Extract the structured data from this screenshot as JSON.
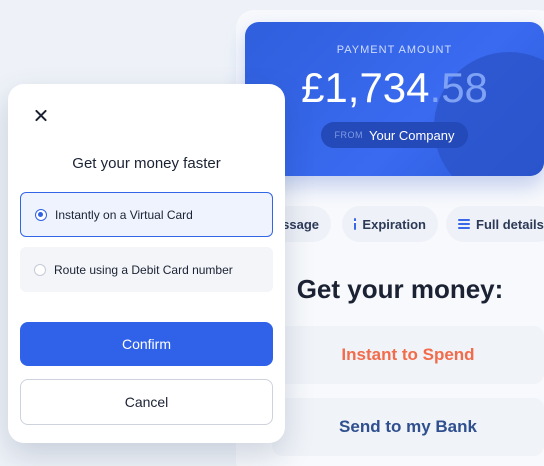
{
  "payment": {
    "label": "PAYMENT AMOUNT",
    "amount_main": "£1,734",
    "amount_cents": ".58",
    "from_label": "FROM",
    "company": "Your Company"
  },
  "chips": {
    "message": "essage",
    "expiration": "Expiration",
    "full_details": "Full details"
  },
  "page": {
    "title": "Get your money:",
    "instant_spend": "Instant to Spend",
    "send_bank": "Send to my Bank"
  },
  "modal": {
    "title": "Get your money faster",
    "options": [
      {
        "label": "Instantly on a Virtual Card",
        "selected": true
      },
      {
        "label": "Route using a Debit Card number",
        "selected": false
      }
    ],
    "confirm_label": "Confirm",
    "cancel_label": "Cancel"
  },
  "colors": {
    "primary": "#2f62e8",
    "instant_spend": "#f26b4a",
    "send_bank": "#2f4f8f"
  }
}
